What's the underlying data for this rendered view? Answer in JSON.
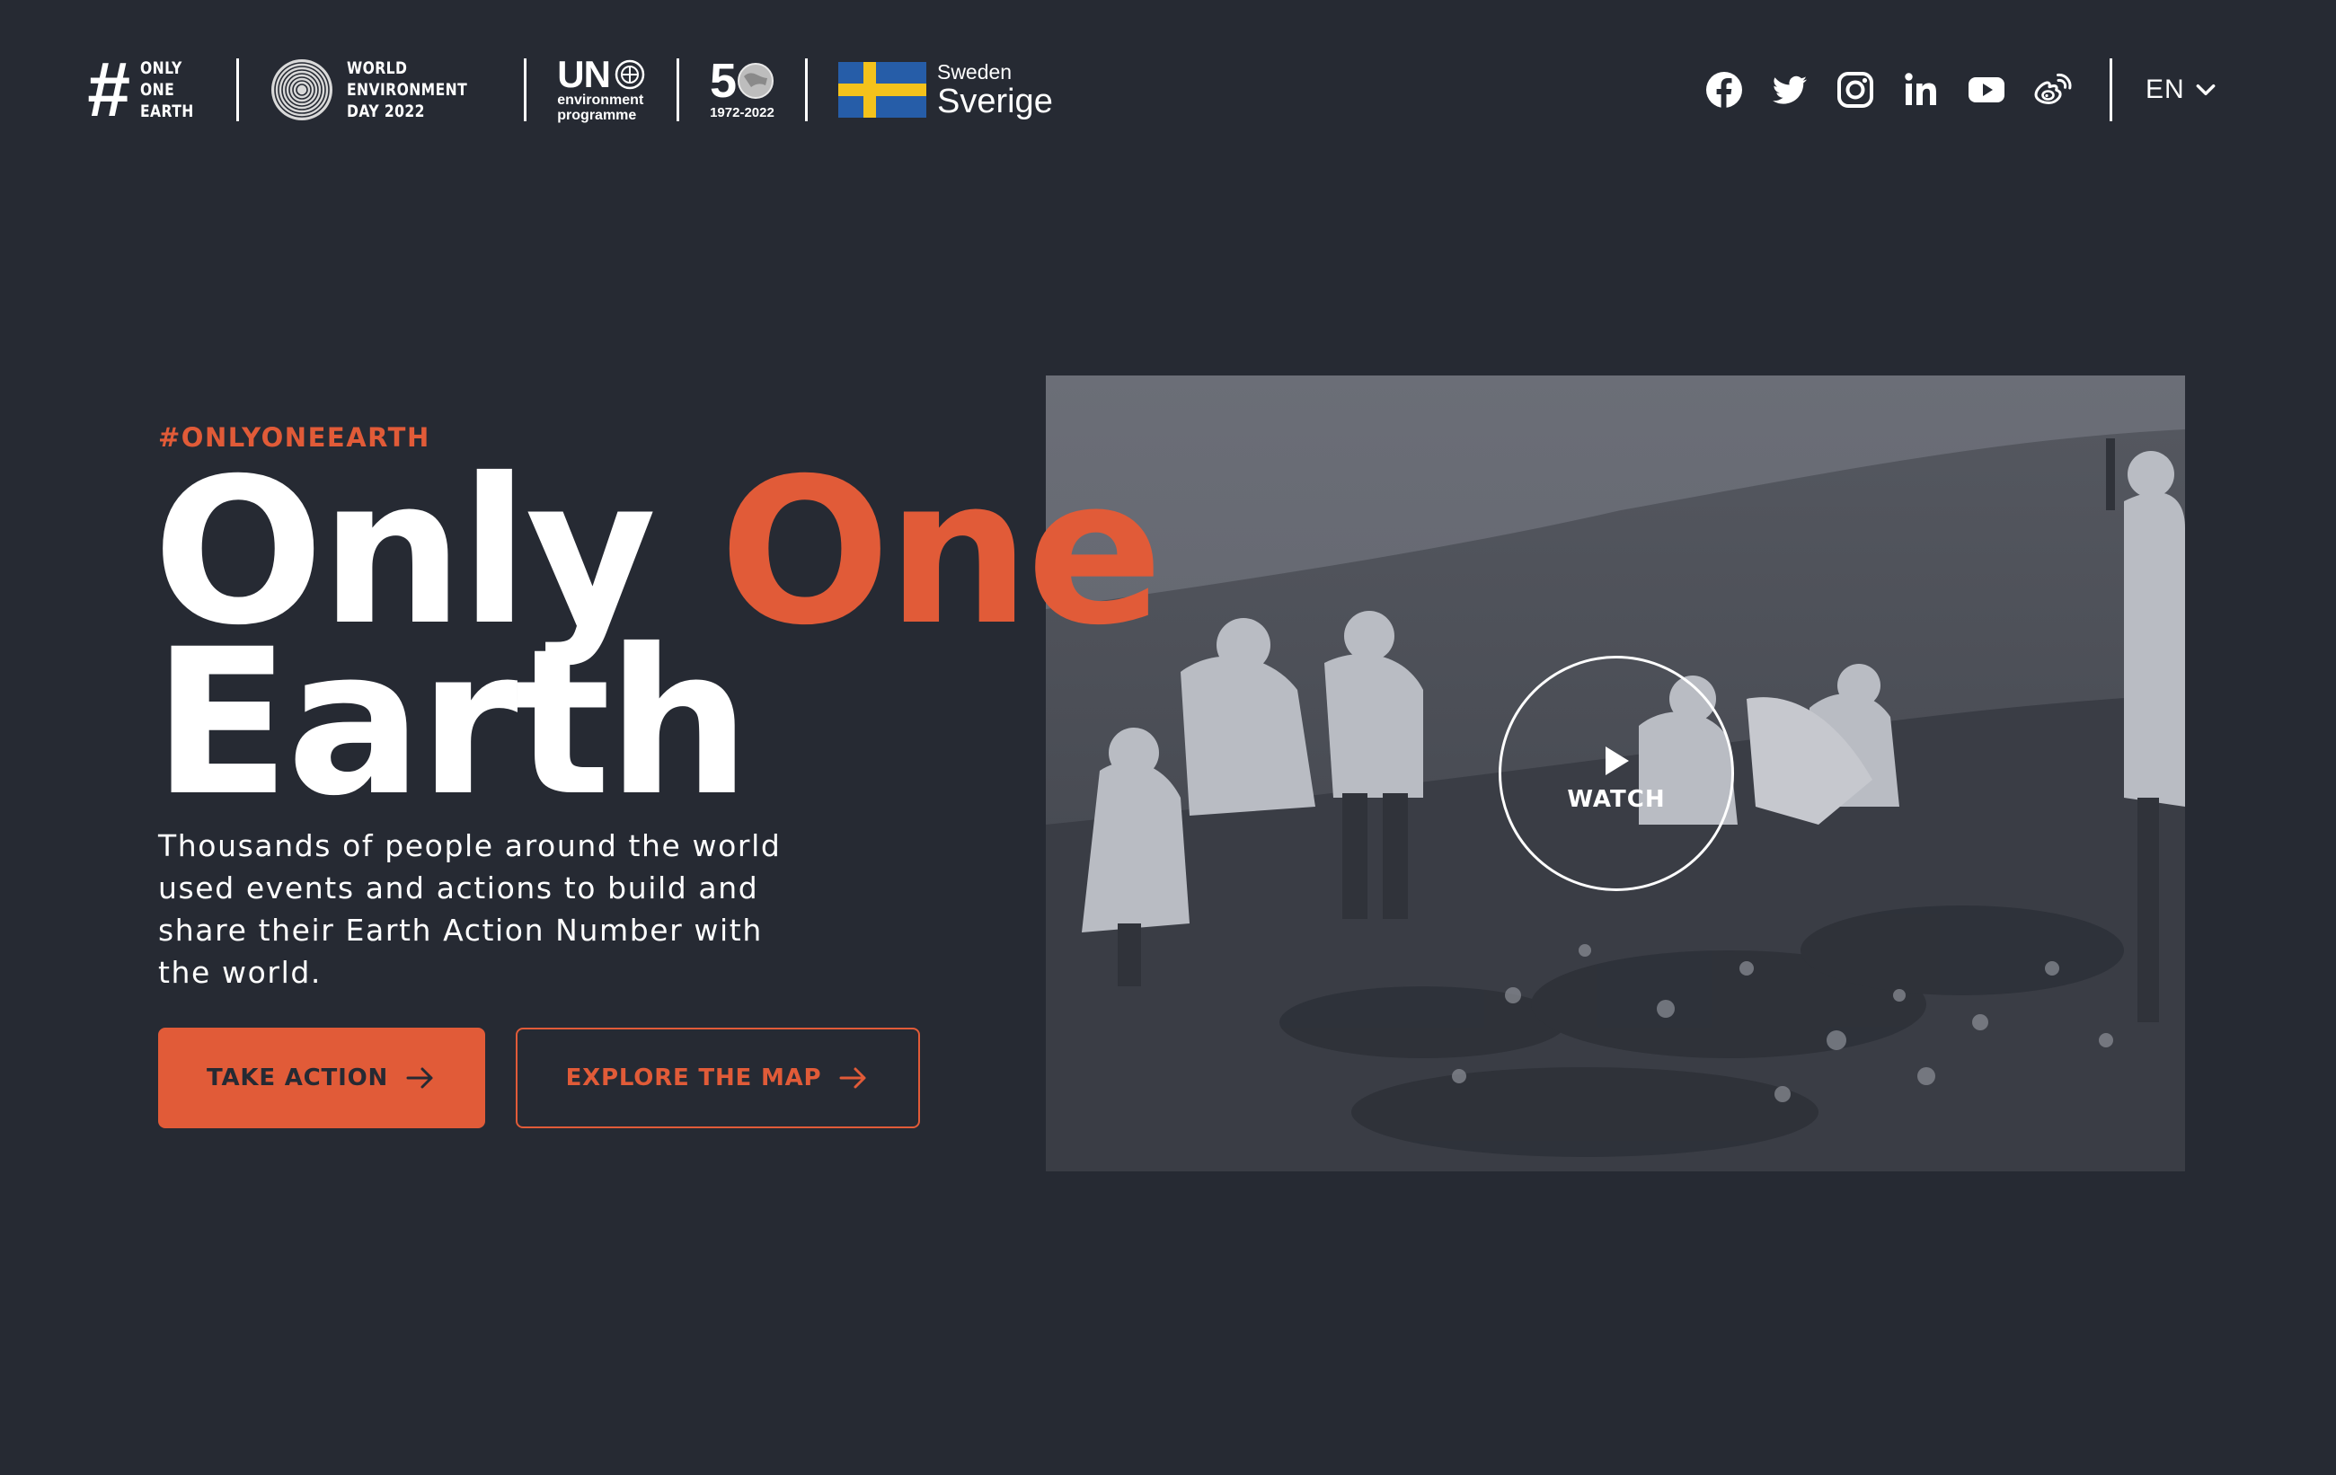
{
  "header": {
    "logos": {
      "only_one_earth": {
        "hash": "#",
        "lines": [
          "ONLY",
          "ONE",
          "EARTH"
        ]
      },
      "world_env_day": {
        "lines": [
          "WORLD",
          "ENVIRONMENT",
          "DAY 2022"
        ]
      },
      "unep": {
        "un": "UN",
        "lines": [
          "environment",
          "programme"
        ]
      },
      "fifty": {
        "number": "5",
        "years": "1972-2022"
      },
      "sweden": {
        "small": "Sweden",
        "large": "Sverige",
        "flag_blue": "#265da8",
        "flag_yellow": "#f4c21b"
      }
    },
    "socials": [
      "facebook-icon",
      "twitter-icon",
      "instagram-icon",
      "linkedin-icon",
      "youtube-icon",
      "weibo-icon"
    ],
    "language": {
      "label": "EN"
    }
  },
  "hero": {
    "tagline": "#ONLYONEEARTH",
    "title_part1": "Only ",
    "title_accent": "One",
    "title_part2": "Earth",
    "description": "Thousands of people around the world used events and actions to build and share their Earth Action Number with the world.",
    "primary_button": "TAKE ACTION",
    "secondary_button": "EXPLORE THE MAP",
    "watch_label": "WATCH"
  },
  "colors": {
    "background": "#262a33",
    "accent": "#e15b38",
    "text": "#ffffff"
  }
}
